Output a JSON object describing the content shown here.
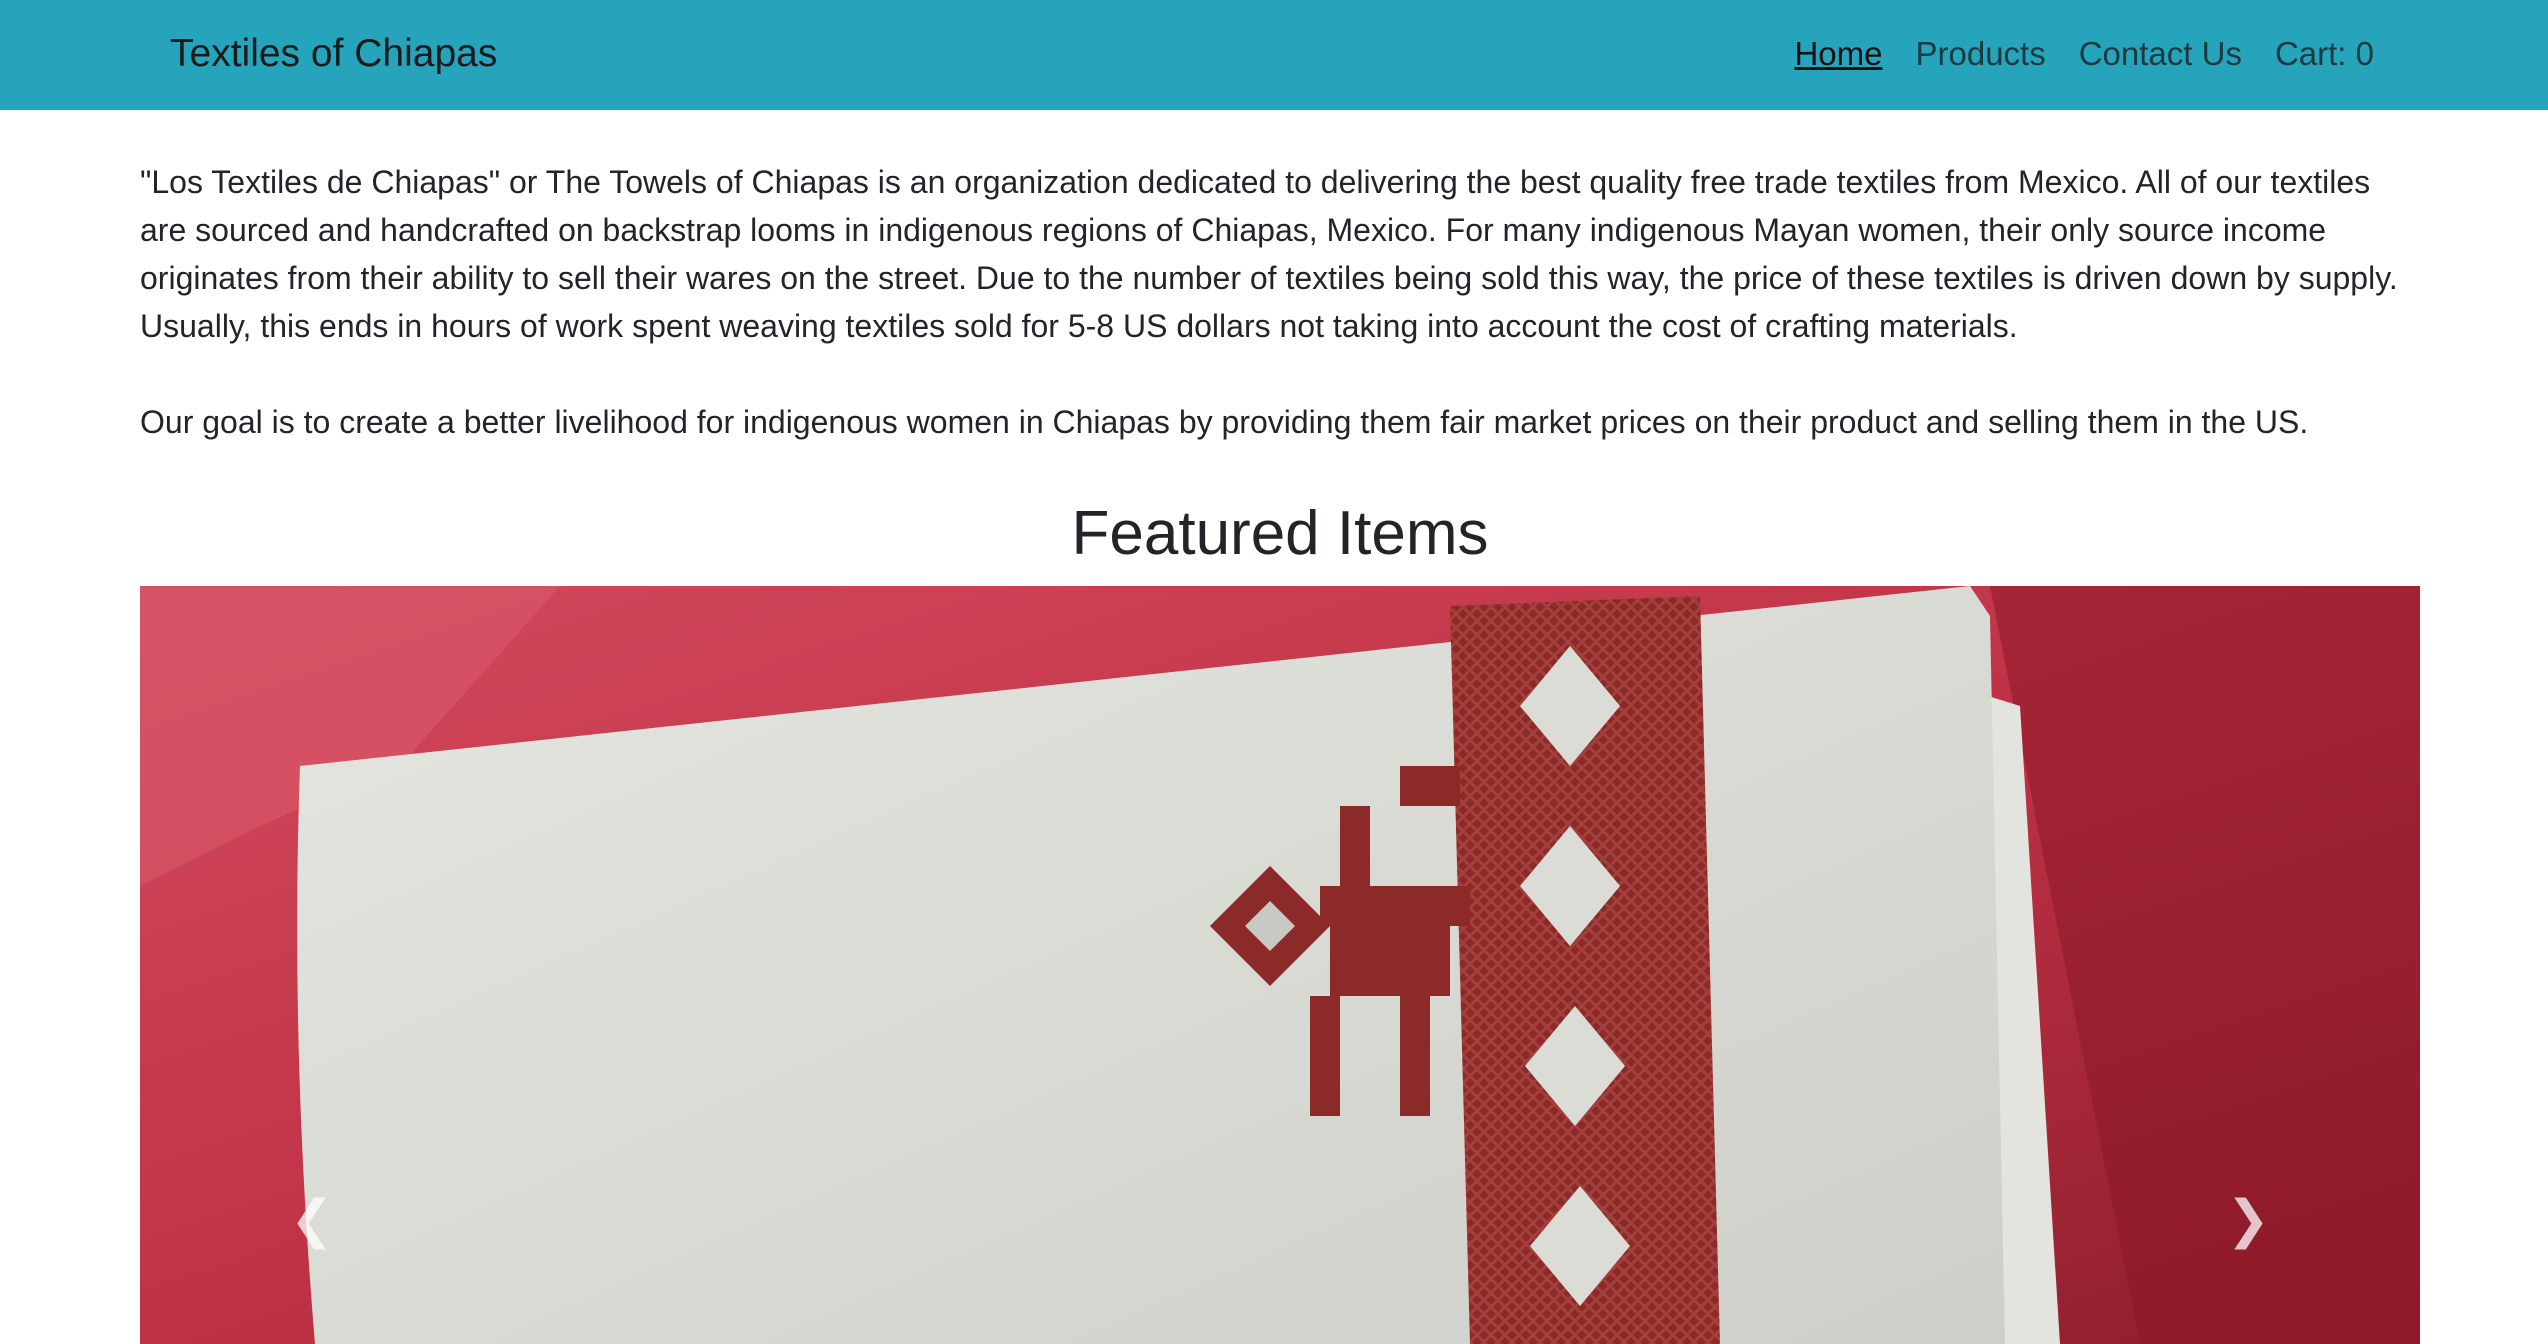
{
  "navbar": {
    "brand": "Textiles of Chiapas",
    "links": [
      {
        "label": "Home",
        "active": true
      },
      {
        "label": "Products"
      },
      {
        "label": "Contact Us"
      },
      {
        "label": "Cart: 0"
      }
    ]
  },
  "main": {
    "about": "\"Los Textiles de Chiapas\" or The Towels of Chiapas is an organization dedicated to delivering the best quality free trade textiles from Mexico. All of our textiles are sourced and handcrafted on backstrap looms in indigenous regions of Chiapas, Mexico. For many indigenous Mayan women, their only source income originates from their ability to sell their wares on the street. Due to the number of textiles being sold this way, the price of these textiles is driven down by supply. Usually, this ends in hours of work spent weaving textiles sold for 5-8 US dollars not taking into account the cost of crafting materials.",
    "goal": "Our goal is to create a better livelihood for indigenous women in Chiapas by providing them fair market prices on their product and selling them in the US.",
    "featured_title": "Featured Items"
  },
  "carousel": {
    "prev_icon": "chevron-left-icon",
    "next_icon": "chevron-right-icon"
  },
  "colors": {
    "navbar": "#26a4bc",
    "background_red": "#c8364a",
    "towel": "#dcdcd6",
    "embroidery": "#8f2a2a"
  }
}
